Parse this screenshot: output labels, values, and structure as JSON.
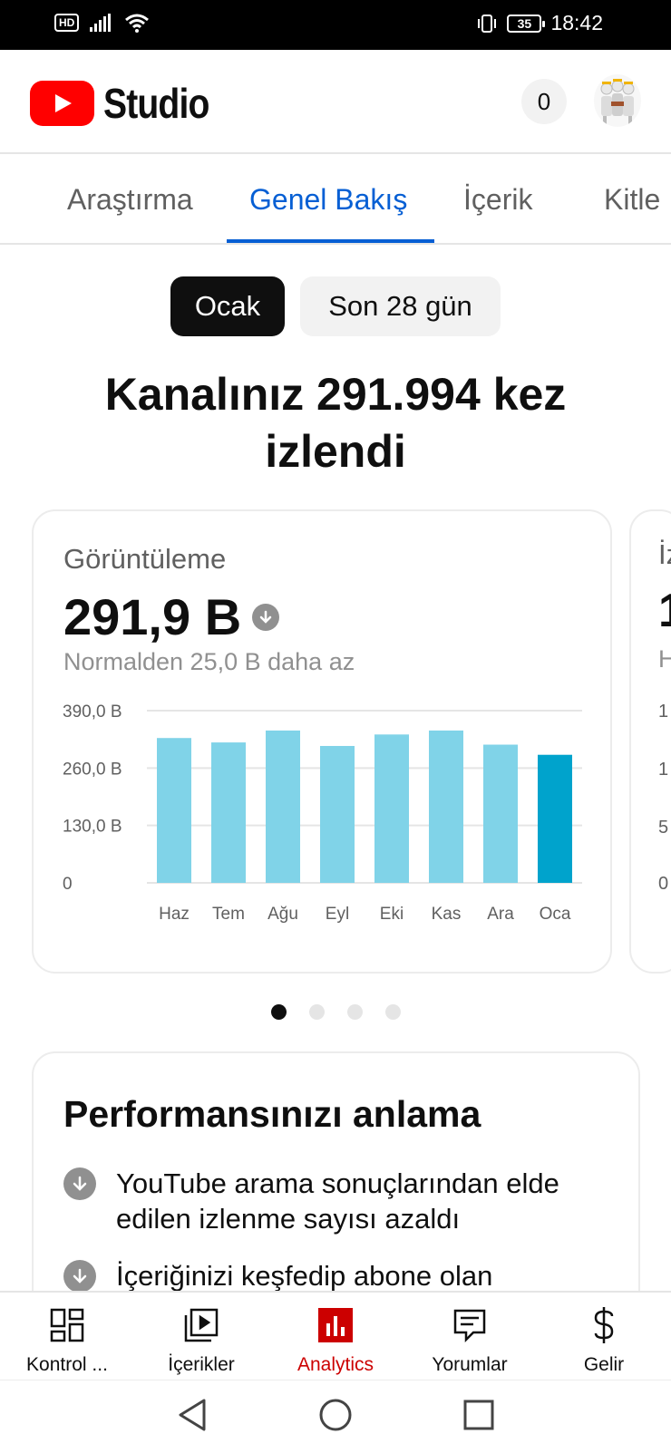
{
  "status_bar": {
    "network": "HD",
    "battery": "35",
    "time": "18:42"
  },
  "header": {
    "logo_text": "Studio",
    "notification_count": "0"
  },
  "tabs": [
    {
      "label": "Araştırma"
    },
    {
      "label": "Genel Bakış"
    },
    {
      "label": "İçerik"
    },
    {
      "label": "Kitle"
    }
  ],
  "active_tab": "Genel Bakış",
  "period_chips": {
    "selected": "Ocak",
    "other": "Son 28 gün"
  },
  "headline": "Kanalınız 291.994 kez izlendi",
  "metric_card": {
    "label": "Görüntüleme",
    "value": "291,9 B",
    "trend_icon": "arrow-down-icon",
    "subtext": "Normalden 25,0 B daha az"
  },
  "peek_card": {
    "label_start": "İz",
    "value_start": "1",
    "sub_start": "H",
    "ticks": [
      "1",
      "1",
      "5",
      "0"
    ]
  },
  "chart_data": {
    "type": "bar",
    "categories": [
      "Haz",
      "Tem",
      "Ağu",
      "Eyl",
      "Eki",
      "Kas",
      "Ara",
      "Oca"
    ],
    "values": [
      328,
      318,
      345,
      310,
      336,
      345,
      313,
      290
    ],
    "highlight_index": 7,
    "y_ticks": [
      "0",
      "130,0 B",
      "260,0 B",
      "390,0 B"
    ],
    "ylim": [
      0,
      390
    ],
    "grid": true,
    "colors": {
      "bar": "#80d3e8",
      "bar_highlight": "#00a3cc",
      "grid": "#e5e5e5"
    }
  },
  "pager": {
    "count": 4,
    "active": 0
  },
  "performance": {
    "title": "Performansınızı anlama",
    "items": [
      {
        "text": "YouTube arama sonuçlarından elde edilen izlenme sayısı azaldı",
        "icon": "arrow-down-icon"
      },
      {
        "text": "İçeriğinizi keşfedip abone olan",
        "icon": "arrow-down-icon"
      }
    ]
  },
  "bottom_nav": [
    {
      "label": "Kontrol ...",
      "icon": "dashboard-icon"
    },
    {
      "label": "İçerikler",
      "icon": "content-icon"
    },
    {
      "label": "Analytics",
      "icon": "analytics-icon"
    },
    {
      "label": "Yorumlar",
      "icon": "comments-icon"
    },
    {
      "label": "Gelir",
      "icon": "dollar-icon"
    }
  ],
  "active_nav": "Analytics",
  "theme": {
    "brand_red": "#ff0000",
    "link_blue": "#065fd4",
    "active_nav_red": "#cc0000"
  }
}
